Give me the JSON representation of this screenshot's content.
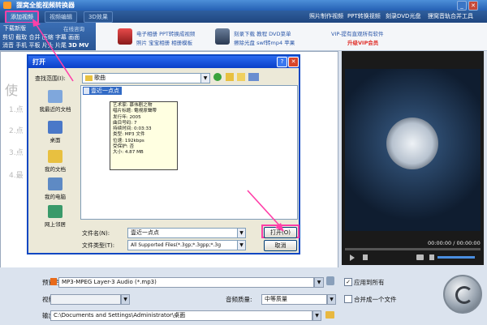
{
  "app": {
    "title": "狸窝全能视频转换器",
    "toolbar": {
      "add_video": "添加视频",
      "video_edit": "视频编辑",
      "effects": "3D效果",
      "links": [
        "照片制作视频",
        "PPT转换视频",
        "刻录DVD光盘",
        "狸窝音轨合并工具"
      ]
    },
    "banner": {
      "download_label": "下载新版",
      "online_help": "在线咨询",
      "functions_row1": [
        "剪切",
        "截取",
        "合并",
        "压缩",
        "字幕",
        "画面"
      ],
      "functions_row2": [
        "消音",
        "手机",
        "平板",
        "片头",
        "片尾",
        "3D",
        "MV"
      ],
      "promo1_line1": "电子相册  PPT转换成视频",
      "promo1_line2": "照片  宝宝相册  相册模板",
      "promo2_line1": "刻录下载  教程  DVD菜单",
      "promo2_line2": "擦除光盘  swf转mp4  苹果",
      "vip_line1": "VIP-提有直观所有软件",
      "vip_line2": "升级VIP会员"
    },
    "left_panel": {
      "heading": "使",
      "steps": [
        "1.点",
        "2.点",
        "3.点",
        "4.最"
      ]
    },
    "preview": {
      "time": "00:00:00 / 00:00:00"
    },
    "bottom": {
      "preset_label": "预置方案:",
      "preset_value": "MP3-MPEG Layer-3 Audio (*.mp3)",
      "apply_all_label": "应用到所有",
      "apply_all_checked": true,
      "video_quality_label": "视频质量:",
      "video_quality_value": "",
      "audio_quality_label": "音频质量:",
      "audio_quality_value": "中等质量",
      "merge_label": "合并成一个文件",
      "merge_checked": false,
      "output_label": "输出目录:",
      "output_value": "C:\\Documents and Settings\\Administrator\\桌面"
    }
  },
  "dialog": {
    "title": "打开",
    "look_in_label": "查找范围(I):",
    "look_in_value": "歌曲",
    "places": [
      "我最近的文档",
      "桌面",
      "我的文档",
      "我的电脑",
      "网上邻居"
    ],
    "files": [
      "壹近一点点"
    ],
    "tooltip": {
      "artist": "艺术家: 慕伟剧之物",
      "album": "唱片标题: 電視原聲帶",
      "year": "发行年: 2005",
      "track": "曲目号码: 7",
      "duration": "持续时间: 0:03:33",
      "type": "类型: MP3 文件",
      "bitrate": "位速: 192kbps",
      "protected": "受保护: 否",
      "size": "大小: 4.87 MB"
    },
    "filename_label": "文件名(N):",
    "filename_value": "壹近一点点",
    "filetype_label": "文件类型(T):",
    "filetype_value": "All Supported Files(*.3gp;*.3gpp;*.3g",
    "open_button": "打开(O)",
    "cancel_button": "取消"
  },
  "colors": {
    "accent_pink": "#ff3fa8",
    "xp_blue": "#0c47c2",
    "vip_red": "#e0302a"
  }
}
